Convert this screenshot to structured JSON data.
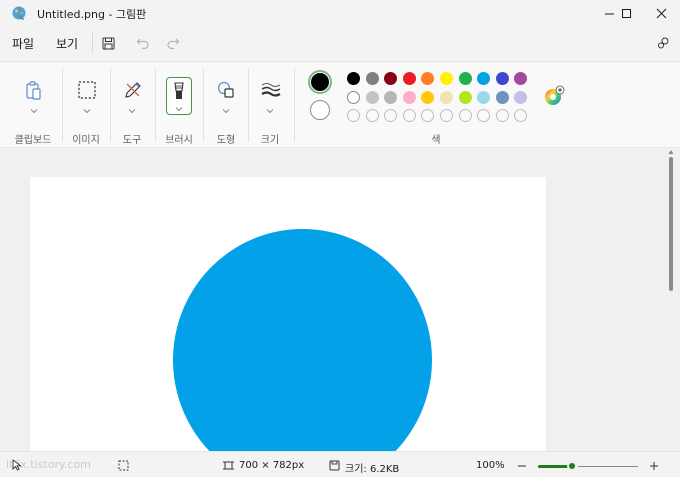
{
  "window": {
    "title": "Untitled.png - 그림판",
    "app_icon": "paint-app-icon",
    "controls": [
      "minimize-icon",
      "maximize-icon",
      "close-icon"
    ]
  },
  "menu": {
    "file": "파일",
    "view": "보기",
    "save_icon": "save-icon",
    "undo_icon": "undo-icon",
    "redo_icon": "redo-icon",
    "share_icon": "settings-icon"
  },
  "ribbon": {
    "groups": {
      "clipboard": "클립보드",
      "image": "이미지",
      "tools": "도구",
      "brushes": "브러시",
      "shapes": "도형",
      "size": "크기",
      "colors": "색"
    },
    "selected_colors": {
      "primary": "#000000",
      "secondary": "#ffffff"
    },
    "palette": {
      "row1": [
        "#000000",
        "#7f7f7f",
        "#880015",
        "#ed1c24",
        "#ff7f27",
        "#fff200",
        "#22b14c",
        "#00a2e8",
        "#3f48cc",
        "#a349a4"
      ],
      "row2": [
        "#ffffff",
        "#c3c3c3",
        "#b5b5b5",
        "#ffaec9",
        "#ffc90e",
        "#efe4b0",
        "#b5e61d",
        "#99d9ea",
        "#7092be",
        "#c8bfe7"
      ]
    },
    "edit_colors_icon": "color-wheel-icon"
  },
  "canvas": {
    "shape_color": "#03a1e7"
  },
  "status": {
    "watermark": "itfix.tistory.com",
    "dimensions": "700 × 782px",
    "size": "크기: 6.2KB",
    "zoom": "100%",
    "zoom_level": 0.35
  }
}
